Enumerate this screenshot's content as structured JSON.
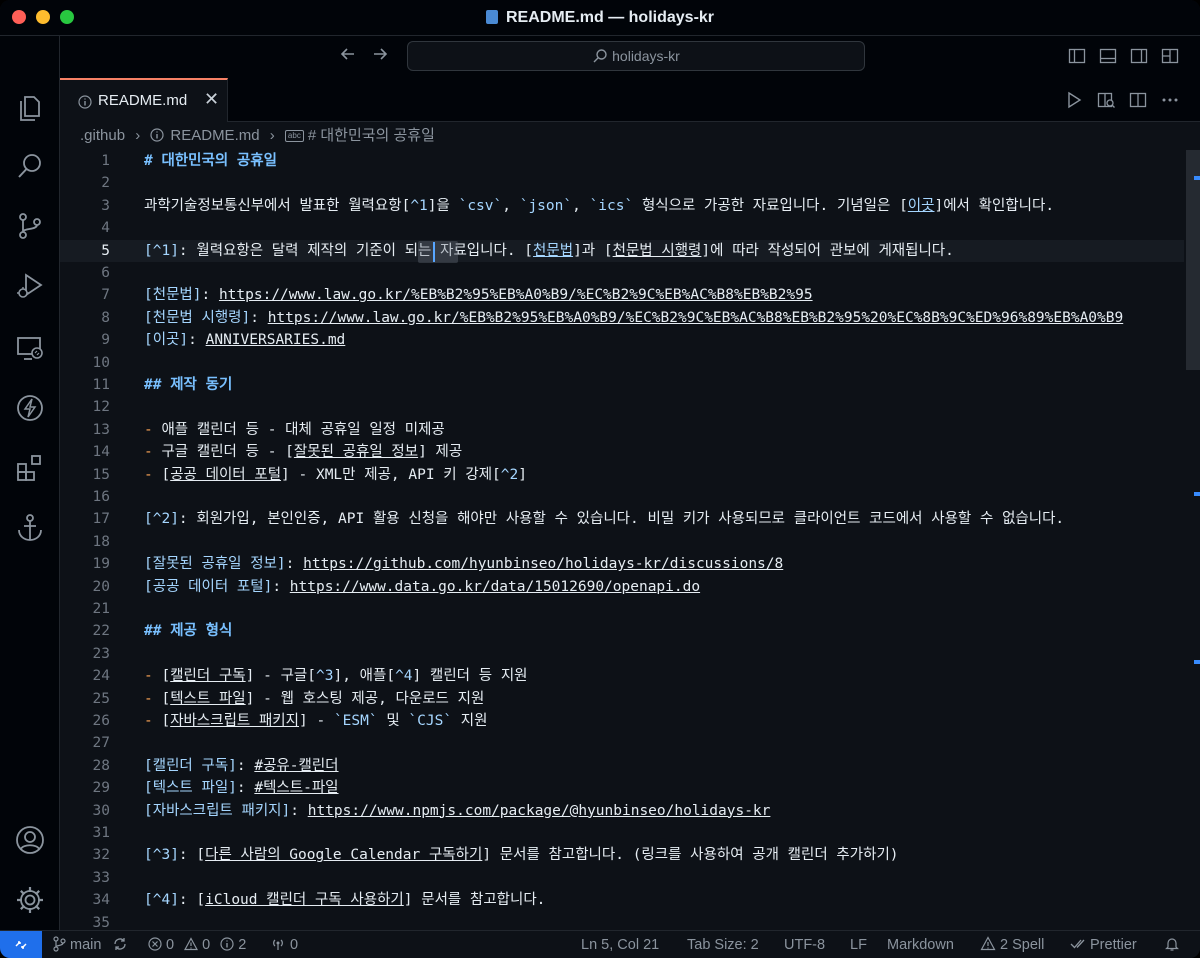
{
  "window": {
    "title": "README.md — holidays-kr"
  },
  "command_center": {
    "search_text": "holidays-kr"
  },
  "tab": {
    "label": "README.md"
  },
  "breadcrumb": {
    "folder": ".github",
    "file": "README.md",
    "symbol": "# 대한민국의 공휴일"
  },
  "editor": {
    "current_line": 5,
    "lines": [
      {
        "n": "1",
        "segs": [
          {
            "t": "# 대한민국의 공휴일",
            "c": "hd"
          }
        ]
      },
      {
        "n": "2",
        "segs": []
      },
      {
        "n": "3",
        "segs": [
          {
            "t": "과학기술정보통신부에서 발표한 월력요항"
          },
          {
            "t": "[",
            "c": "br"
          },
          {
            "t": "^1",
            "c": "ic"
          },
          {
            "t": "]"
          },
          {
            "t": "을 "
          },
          {
            "t": "`csv`",
            "c": "ic"
          },
          {
            "t": ", "
          },
          {
            "t": "`json`",
            "c": "ic"
          },
          {
            "t": ", "
          },
          {
            "t": "`ics`",
            "c": "ic"
          },
          {
            "t": " 형식으로 가공한 자료입니다. 기념일은 "
          },
          {
            "t": "["
          },
          {
            "t": "이곳",
            "c": "lk"
          },
          {
            "t": "]"
          },
          {
            "t": "에서 확인합니다."
          }
        ]
      },
      {
        "n": "4",
        "segs": []
      },
      {
        "n": "5",
        "segs": [
          {
            "t": "[^1]",
            "c": "ic"
          },
          {
            "t": ": 월력요항은 달력 제작의 기준이 되는 자료입니다. "
          },
          {
            "t": "["
          },
          {
            "t": "천문법",
            "c": "lk"
          },
          {
            "t": "]"
          },
          {
            "t": "과 "
          },
          {
            "t": "["
          },
          {
            "t": "천문법 시행령",
            "c": "lk2"
          },
          {
            "t": "]"
          },
          {
            "t": "에 따라 작성되어 관보에 게재됩니다."
          }
        ]
      },
      {
        "n": "6",
        "segs": []
      },
      {
        "n": "7",
        "segs": [
          {
            "t": "[천문법]",
            "c": "ic"
          },
          {
            "t": ": "
          },
          {
            "t": "https://www.law.go.kr/%EB%B2%95%EB%A0%B9/%EC%B2%9C%EB%AC%B8%EB%B2%95",
            "c": "lk2"
          }
        ]
      },
      {
        "n": "8",
        "segs": [
          {
            "t": "[천문법 시행령]",
            "c": "ic"
          },
          {
            "t": ": "
          },
          {
            "t": "https://www.law.go.kr/%EB%B2%95%EB%A0%B9/%EC%B2%9C%EB%AC%B8%EB%B2%95%20%EC%8B%9C%ED%96%89%EB%A0%B9",
            "c": "lk2"
          }
        ]
      },
      {
        "n": "9",
        "segs": [
          {
            "t": "[이곳]",
            "c": "ic"
          },
          {
            "t": ": "
          },
          {
            "t": "ANNIVERSARIES.md",
            "c": "lk2"
          }
        ]
      },
      {
        "n": "10",
        "segs": []
      },
      {
        "n": "11",
        "segs": [
          {
            "t": "## 제작 동기",
            "c": "hd"
          }
        ]
      },
      {
        "n": "12",
        "segs": []
      },
      {
        "n": "13",
        "segs": [
          {
            "t": "- ",
            "c": "mk"
          },
          {
            "t": "애플 캘린더 등 - 대체 공휴일 일정 미제공"
          }
        ]
      },
      {
        "n": "14",
        "segs": [
          {
            "t": "- ",
            "c": "mk"
          },
          {
            "t": "구글 캘린더 등 - "
          },
          {
            "t": "["
          },
          {
            "t": "잘못된 공휴일 정보",
            "c": "lk2"
          },
          {
            "t": "]"
          },
          {
            "t": " 제공"
          }
        ]
      },
      {
        "n": "15",
        "segs": [
          {
            "t": "- ",
            "c": "mk"
          },
          {
            "t": "["
          },
          {
            "t": "공공 데이터 포털",
            "c": "lk2"
          },
          {
            "t": "]"
          },
          {
            "t": " - XML만 제공, API 키 강제"
          },
          {
            "t": "["
          },
          {
            "t": "^2",
            "c": "ic"
          },
          {
            "t": "]"
          }
        ]
      },
      {
        "n": "16",
        "segs": []
      },
      {
        "n": "17",
        "segs": [
          {
            "t": "[^2]",
            "c": "ic"
          },
          {
            "t": ": 회원가입, 본인인증, API 활용 신청을 해야만 사용할 수 있습니다. 비밀 키가 사용되므로 클라이언트 코드에서 사용할 수 없습니다."
          }
        ]
      },
      {
        "n": "18",
        "segs": []
      },
      {
        "n": "19",
        "segs": [
          {
            "t": "[잘못된 공휴일 정보]",
            "c": "ic"
          },
          {
            "t": ": "
          },
          {
            "t": "https://github.com/hyunbinseo/holidays-kr/discussions/8",
            "c": "lk2"
          }
        ]
      },
      {
        "n": "20",
        "segs": [
          {
            "t": "[공공 데이터 포털]",
            "c": "ic"
          },
          {
            "t": ": "
          },
          {
            "t": "https://www.data.go.kr/data/15012690/openapi.do",
            "c": "lk2"
          }
        ]
      },
      {
        "n": "21",
        "segs": []
      },
      {
        "n": "22",
        "segs": [
          {
            "t": "## 제공 형식",
            "c": "hd"
          }
        ]
      },
      {
        "n": "23",
        "segs": []
      },
      {
        "n": "24",
        "segs": [
          {
            "t": "- ",
            "c": "mk"
          },
          {
            "t": "["
          },
          {
            "t": "캘린더 구독",
            "c": "lk2"
          },
          {
            "t": "]"
          },
          {
            "t": " - 구글"
          },
          {
            "t": "["
          },
          {
            "t": "^3",
            "c": "ic"
          },
          {
            "t": "]"
          },
          {
            "t": ", 애플"
          },
          {
            "t": "["
          },
          {
            "t": "^4",
            "c": "ic"
          },
          {
            "t": "]"
          },
          {
            "t": " 캘린더 등 지원"
          }
        ]
      },
      {
        "n": "25",
        "segs": [
          {
            "t": "- ",
            "c": "mk"
          },
          {
            "t": "["
          },
          {
            "t": "텍스트 파일",
            "c": "lk2"
          },
          {
            "t": "]"
          },
          {
            "t": " - 웹 호스팅 제공, 다운로드 지원"
          }
        ]
      },
      {
        "n": "26",
        "segs": [
          {
            "t": "- ",
            "c": "mk"
          },
          {
            "t": "["
          },
          {
            "t": "자바스크립트 패키지",
            "c": "lk2"
          },
          {
            "t": "]"
          },
          {
            "t": " - "
          },
          {
            "t": "`ESM`",
            "c": "ic"
          },
          {
            "t": " 및 "
          },
          {
            "t": "`CJS`",
            "c": "ic"
          },
          {
            "t": " 지원"
          }
        ]
      },
      {
        "n": "27",
        "segs": []
      },
      {
        "n": "28",
        "segs": [
          {
            "t": "[캘린더 구독]",
            "c": "ic"
          },
          {
            "t": ": "
          },
          {
            "t": "#공유-캘린더",
            "c": "lk2"
          }
        ]
      },
      {
        "n": "29",
        "segs": [
          {
            "t": "[텍스트 파일]",
            "c": "ic"
          },
          {
            "t": ": "
          },
          {
            "t": "#텍스트-파일",
            "c": "lk2"
          }
        ]
      },
      {
        "n": "30",
        "segs": [
          {
            "t": "[자바스크립트 패키지]",
            "c": "ic"
          },
          {
            "t": ": "
          },
          {
            "t": "https://www.npmjs.com/package/@hyunbinseo/holidays-kr",
            "c": "lk2"
          }
        ]
      },
      {
        "n": "31",
        "segs": []
      },
      {
        "n": "32",
        "segs": [
          {
            "t": "[^3]",
            "c": "ic"
          },
          {
            "t": ": "
          },
          {
            "t": "["
          },
          {
            "t": "다른 사람의 Google Calendar 구독하기",
            "c": "lk2"
          },
          {
            "t": "]"
          },
          {
            "t": " 문서를 참고합니다. (링크를 사용하여 공개 캘린더 추가하기)"
          }
        ]
      },
      {
        "n": "33",
        "segs": []
      },
      {
        "n": "34",
        "segs": [
          {
            "t": "[^4]",
            "c": "ic"
          },
          {
            "t": ": "
          },
          {
            "t": "["
          },
          {
            "t": "iCloud 캘린더 구독 사용하기",
            "c": "lk2"
          },
          {
            "t": "]"
          },
          {
            "t": " 문서를 참고합니다."
          }
        ]
      },
      {
        "n": "35",
        "segs": []
      }
    ]
  },
  "statusbar": {
    "branch": "main",
    "errors": "0",
    "warnings": "0",
    "infos": "2",
    "ports": "0",
    "position": "Ln 5, Col 21",
    "tab_size": "Tab Size: 2",
    "encoding": "UTF-8",
    "eol": "LF",
    "language": "Markdown",
    "spell": "2 Spell",
    "formatter": "Prettier"
  },
  "icons": [
    "files-icon",
    "search-icon",
    "source-control-icon",
    "run-debug-icon",
    "remote-explorer-icon",
    "lightning-icon",
    "extensions-icon",
    "anchor-icon",
    "account-icon",
    "settings-gear-icon"
  ],
  "colors": {
    "accent": "#1f6feb",
    "tab_border": "#f78166",
    "heading": "#79c0ff",
    "list_marker": "#ffa657",
    "link": "#a5d6ff"
  }
}
